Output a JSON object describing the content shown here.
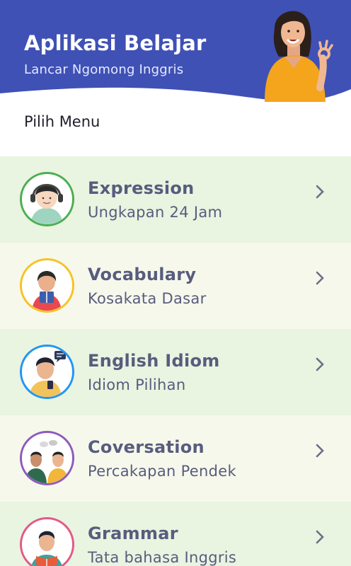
{
  "header": {
    "title": "Aplikasi Belajar",
    "subtitle": "Lancar Ngomong Inggris",
    "bg_color": "#3f51b5"
  },
  "section_label": "Pilih Menu",
  "menu": [
    {
      "title": "Expression",
      "subtitle": "Ungkapan 24 Jam",
      "ring_color": "#4caf50",
      "bg_color": "#e9f4e1",
      "icon": "girl-headphones-icon"
    },
    {
      "title": "Vocabulary",
      "subtitle": "Kosakata Dasar",
      "ring_color": "#f6c324",
      "bg_color": "#f7f8ec",
      "icon": "girl-reading-icon"
    },
    {
      "title": "English Idiom",
      "subtitle": "Idiom Pilihan",
      "ring_color": "#2196f3",
      "bg_color": "#e9f4e1",
      "icon": "boy-phone-chat-icon"
    },
    {
      "title": "Coversation",
      "subtitle": "Percakapan Pendek",
      "ring_color": "#8e5bbd",
      "bg_color": "#f7f8ec",
      "icon": "two-men-talking-icon"
    },
    {
      "title": "Grammar",
      "subtitle": "Tata bahasa Inggris",
      "ring_color": "#e25a86",
      "bg_color": "#e9f4e1",
      "icon": "boy-reading-book-icon"
    }
  ]
}
